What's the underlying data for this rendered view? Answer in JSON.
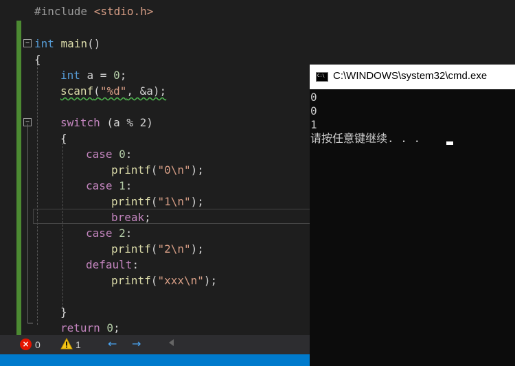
{
  "editor": {
    "include_directive": "#include",
    "include_file": "<stdio.h>",
    "main_type": "int",
    "main_name": "main",
    "main_parens": "()",
    "open_brace": "{",
    "decl_type": "int",
    "decl_rest": " a = ",
    "decl_value": "0",
    "decl_end": ";",
    "scanf_name": "scanf",
    "scanf_open": "(",
    "scanf_format": "\"%d\"",
    "scanf_rest": ", &a);",
    "switch_kw": "switch",
    "switch_expr": " (a % 2)",
    "switch_open": "{",
    "case_kw_0": "case",
    "case_val_0": " 0",
    "case_colon_0": ":",
    "printf_0": "printf",
    "printf_0_open": "(",
    "printf_0_str": "\"0\\n\"",
    "printf_0_close": ");",
    "case_kw_1": "case",
    "case_val_1": " 1",
    "case_colon_1": ":",
    "printf_1": "printf",
    "printf_1_open": "(",
    "printf_1_str": "\"1\\n\"",
    "printf_1_close": ");",
    "break_kw": "break",
    "break_end": ";",
    "case_kw_2": "case",
    "case_val_2": " 2",
    "case_colon_2": ":",
    "printf_2": "printf",
    "printf_2_open": "(",
    "printf_2_str": "\"2\\n\"",
    "printf_2_close": ");",
    "default_kw": "default",
    "default_colon": ":",
    "printf_3": "printf",
    "printf_3_open": "(",
    "printf_3_str": "\"xxx\\n\"",
    "printf_3_close": ");",
    "switch_close": "}",
    "return_kw": "return",
    "return_val": " 0",
    "return_end": ";"
  },
  "status_bar": {
    "error_count": "0",
    "warning_count": "1",
    "nav_back": "←",
    "nav_forward": "→"
  },
  "console": {
    "title": "C:\\WINDOWS\\system32\\cmd.exe",
    "icon_text": "C:\\",
    "lines": [
      "0",
      "0",
      "1",
      "请按任意键继续. . ."
    ]
  },
  "colors": {
    "keyword": "#569cd6",
    "control": "#c586c0",
    "function": "#dcdcaa",
    "string": "#d69d85",
    "number": "#b5cea8",
    "accent": "#007acc"
  }
}
